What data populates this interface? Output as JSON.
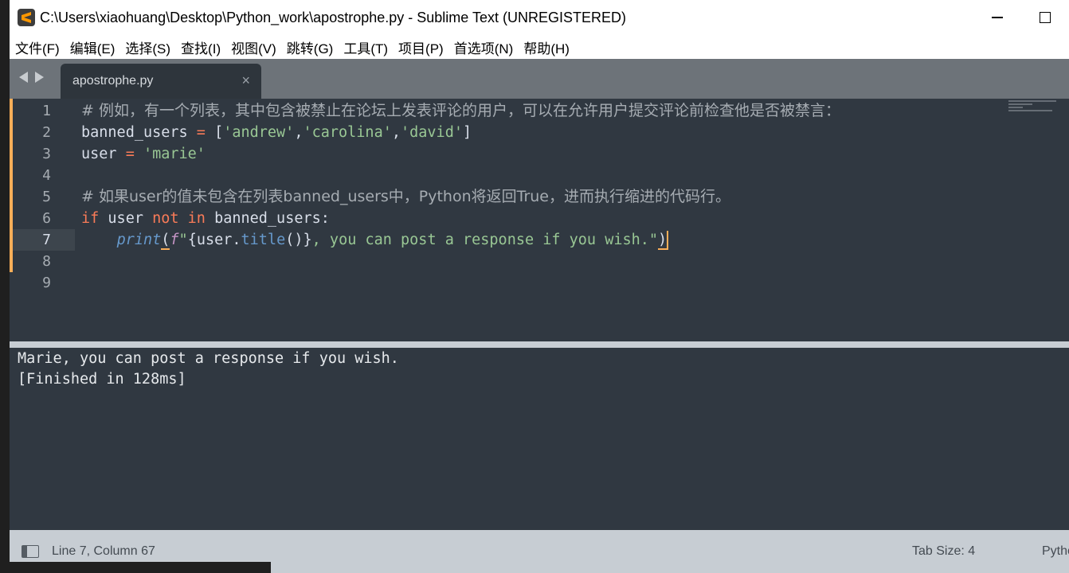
{
  "window": {
    "title": "C:\\Users\\xiaohuang\\Desktop\\Python_work\\apostrophe.py - Sublime Text (UNREGISTERED)",
    "app_icon": "sublime-text-icon"
  },
  "menu": [
    {
      "label": "文件(F)"
    },
    {
      "label": "编辑(E)"
    },
    {
      "label": "选择(S)"
    },
    {
      "label": "查找(I)"
    },
    {
      "label": "视图(V)"
    },
    {
      "label": "跳转(G)"
    },
    {
      "label": "工具(T)"
    },
    {
      "label": "项目(P)"
    },
    {
      "label": "首选项(N)"
    },
    {
      "label": "帮助(H)"
    }
  ],
  "tab": {
    "label": "apostrophe.py",
    "close": "×"
  },
  "editor": {
    "line_numbers": [
      "1",
      "2",
      "3",
      "4",
      "5",
      "6",
      "7",
      "8",
      "9"
    ],
    "active_line": 7,
    "code": {
      "l1": "# 例如，有一个列表，其中包含被禁止在论坛上发表评论的用户，可以在允许用户提交评论前检查他是否被禁言：",
      "l2_a": "banned_users ",
      "l2_b": "=",
      "l2_c": " [",
      "l2_d": "'andrew'",
      "l2_e": ",",
      "l2_f": "'carolina'",
      "l2_g": ",",
      "l2_h": "'david'",
      "l2_i": "]",
      "l3_a": "user ",
      "l3_b": "=",
      "l3_c": " ",
      "l3_d": "'marie'",
      "l5": "# 如果user的值未包含在列表banned_users中，Python将返回True，进而执行缩进的代码行。",
      "l6_a": "if",
      "l6_b": " user ",
      "l6_c": "not",
      "l6_d": " ",
      "l6_e": "in",
      "l6_f": " banned_users:",
      "l7_indent": "    ",
      "l7_print": "print",
      "l7_open": "(",
      "l7_f": "f",
      "l7_q": "\"",
      "l7_brace1": "{user",
      "l7_dot": ".",
      "l7_title": "title",
      "l7_call": "()}",
      "l7_rest": ", you can post a response if you wish.\"",
      "l7_close": ")"
    }
  },
  "output": {
    "lines": [
      "Marie, you can post a response if you wish.",
      "[Finished in 128ms]"
    ]
  },
  "status": {
    "position": "Line 7, Column 67",
    "tab_size": "Tab Size: 4",
    "syntax": "Python"
  },
  "colors": {
    "editor_bg": "#303841",
    "comment": "#a6acb2",
    "operator": "#f97b58",
    "string": "#99c794",
    "function": "#6699cc",
    "accent": "#f9ae58"
  }
}
